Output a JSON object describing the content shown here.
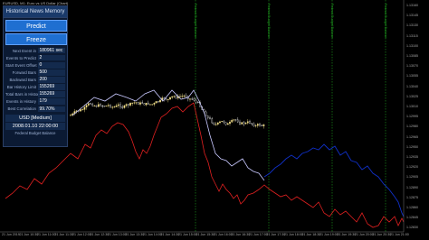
{
  "window": {
    "title": "EURUSD, M1: Euro vs US Dollar (Chart)"
  },
  "panel": {
    "title": "Historical News Memory",
    "predict_label": "Predict",
    "freeze_label": "Freeze",
    "rows": [
      {
        "label": "Next Event in",
        "value": "180961 sec"
      },
      {
        "label": "Events to Predict",
        "value": "2"
      },
      {
        "label": "Start Event Offset",
        "value": "0"
      },
      {
        "label": "Forward Bars",
        "value": "500"
      },
      {
        "label": "Backward Bars",
        "value": "200"
      },
      {
        "label": "Bar History Limit",
        "value": "155269"
      },
      {
        "label": "Total Bars in History",
        "value": "155269"
      },
      {
        "label": "Events in History",
        "value": "179"
      },
      {
        "label": "Best Correlation",
        "value": "99.70%"
      }
    ],
    "currency": "USD [Medium]",
    "date": "2008.01.10 22:00:00",
    "event": "Federal Budget Balance"
  },
  "markers": {
    "text": "Federal Budget Balance"
  },
  "axis": {
    "x_labels": [
      "21 Jun 2019",
      "21 Jun 10:30",
      "21 Jun 11:00",
      "21 Jun 11:30",
      "21 Jun 12:00",
      "21 Jun 12:30",
      "21 Jun 13:00",
      "21 Jun 13:30",
      "21 Jun 14:00",
      "21 Jun 14:30",
      "21 Jun 15:00",
      "21 Jun 15:30",
      "21 Jun 16:00",
      "21 Jun 16:30",
      "21 Jun 17:00",
      "21 Jun 17:30",
      "21 Jun 18:00",
      "21 Jun 18:30",
      "21 Jun 19:00",
      "21 Jun 19:30",
      "21 Jun 20:00",
      "21 Jun 20:30",
      "21 Jun 21:00"
    ],
    "y_labels": [
      "1.13160",
      "1.13145",
      "1.13130",
      "1.13115",
      "1.13100",
      "1.13085",
      "1.13070",
      "1.13055",
      "1.13040",
      "1.13025",
      "1.13010",
      "1.12995",
      "1.12980",
      "1.12965",
      "1.12950",
      "1.12935",
      "1.12920",
      "1.12905",
      "1.12890",
      "1.12875",
      "1.12860",
      "1.12845",
      "1.12830"
    ]
  },
  "colors": {
    "background": "#000000",
    "bull_candle": "#f5e28a",
    "bear_candle": "#ffffff",
    "forecast_red": "#e02020",
    "forecast_blue": "#1030c8",
    "overlay_white": "#c8c8ff",
    "marker_green": "#1fa01f"
  }
}
